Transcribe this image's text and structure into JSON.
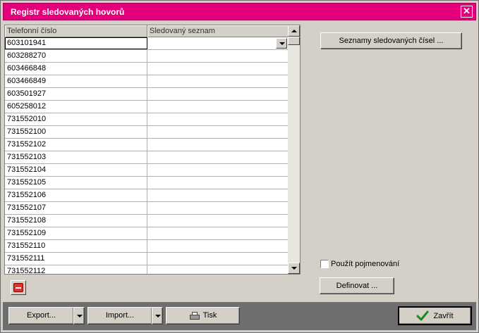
{
  "window": {
    "title": "Registr sledovaných hovorů",
    "close_glyph": "✕",
    "accent_color": "#e4007a"
  },
  "grid": {
    "columns": [
      "Telefonní číslo",
      "Sledovaný seznam"
    ],
    "rows": [
      {
        "phone": "603101941",
        "list": ""
      },
      {
        "phone": "603288270",
        "list": ""
      },
      {
        "phone": "603466848",
        "list": ""
      },
      {
        "phone": "603466849",
        "list": ""
      },
      {
        "phone": "603501927",
        "list": ""
      },
      {
        "phone": "605258012",
        "list": ""
      },
      {
        "phone": "731552010",
        "list": ""
      },
      {
        "phone": "731552100",
        "list": ""
      },
      {
        "phone": "731552102",
        "list": ""
      },
      {
        "phone": "731552103",
        "list": ""
      },
      {
        "phone": "731552104",
        "list": ""
      },
      {
        "phone": "731552105",
        "list": ""
      },
      {
        "phone": "731552106",
        "list": ""
      },
      {
        "phone": "731552107",
        "list": ""
      },
      {
        "phone": "731552108",
        "list": ""
      },
      {
        "phone": "731552109",
        "list": ""
      },
      {
        "phone": "731552110",
        "list": ""
      },
      {
        "phone": "731552111",
        "list": ""
      },
      {
        "phone": "731552112",
        "list": ""
      }
    ]
  },
  "side": {
    "lists_button": "Seznamy sledovaných čísel ...",
    "use_names_label": "Použít pojmenování",
    "use_names_checked": false,
    "define_button": "Definovat ..."
  },
  "toolbar": {
    "export_label": "Export...",
    "import_label": "Import...",
    "print_label": "Tisk",
    "close_label": "Zavřít"
  },
  "icons": {
    "delete": "minus-icon",
    "print": "printer-icon",
    "close": "check-icon"
  }
}
